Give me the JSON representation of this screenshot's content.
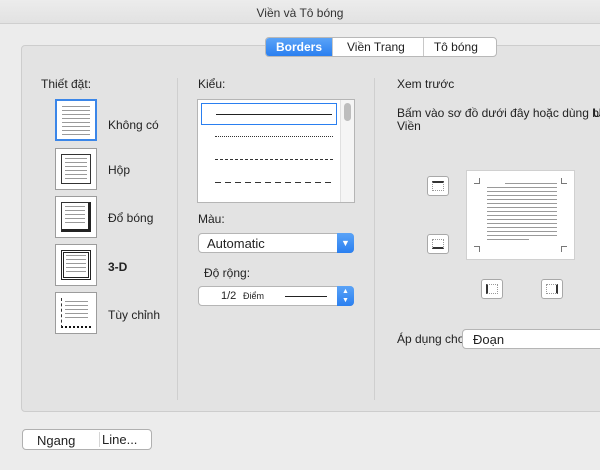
{
  "window": {
    "title": "Viền và Tô bóng"
  },
  "tabs": [
    "Borders",
    "Viền Trang",
    "Tô bóng"
  ],
  "setting": {
    "label": "Thiết đặt:",
    "options": [
      {
        "label": "Không có",
        "icon": "border-none-icon"
      },
      {
        "label": "Hộp",
        "icon": "border-box-icon"
      },
      {
        "label": "Đổ bóng",
        "icon": "border-shadow-icon"
      },
      {
        "label": "3-D",
        "icon": "border-3d-icon"
      },
      {
        "label": "Tùy chỉnh",
        "icon": "border-custom-icon"
      }
    ]
  },
  "style": {
    "label": "Kiểu:"
  },
  "color": {
    "label": "Màu:",
    "value": "Automatic"
  },
  "width": {
    "label": "Độ rộng:",
    "value": "1/2",
    "unit": "Điểm"
  },
  "preview": {
    "label": "Xem trước",
    "hint_line1": "Bấm vào sơ đồ dưới đây hoặc dùng b",
    "hint_line2": "Viền"
  },
  "apply": {
    "label": "Áp dụng cho:",
    "value": "Đoạn"
  },
  "bottom_buttons": {
    "horizontal": "Ngang",
    "line": "Line..."
  },
  "colors": {
    "accent": "#2a7ff0",
    "accent_light": "#5aa3f7"
  }
}
